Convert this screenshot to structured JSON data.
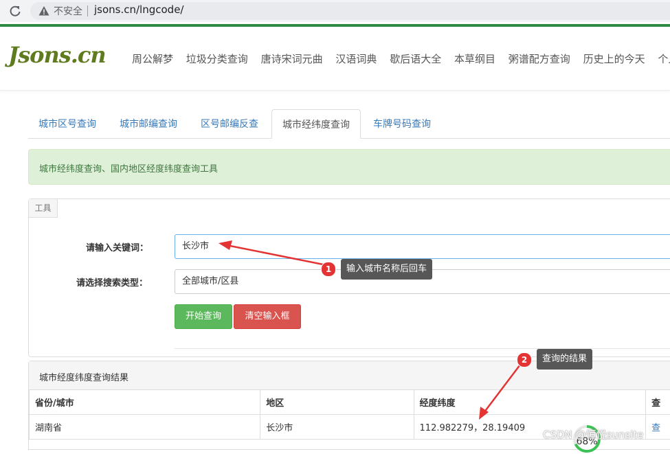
{
  "browser": {
    "insecure_label": "不安全",
    "url": "jsons.cn/lngcode/"
  },
  "site": {
    "logo": "Jsons.cn",
    "nav": [
      "周公解梦",
      "垃圾分类查询",
      "唐诗宋词元曲",
      "汉语词典",
      "歇后语大全",
      "本草纲目",
      "粥谱配方查询",
      "历史上的今天",
      "个人所得"
    ]
  },
  "tabs": [
    {
      "label": "城市区号查询",
      "active": false
    },
    {
      "label": "城市邮编查询",
      "active": false
    },
    {
      "label": "区号邮编反查",
      "active": false
    },
    {
      "label": "城市经纬度查询",
      "active": true
    },
    {
      "label": "车牌号码查询",
      "active": false
    }
  ],
  "alert": "城市经纬度查询、国内地区经度纬度查询工具",
  "tool": {
    "tag": "工具",
    "keyword_label": "请输入关键词：",
    "keyword_value": "长沙市",
    "type_label": "请选择搜索类型：",
    "type_value": "全部城市/区县",
    "search_button": "开始查询",
    "clear_button": "清空输入框"
  },
  "results": {
    "title": "城市经度纬度查询结果",
    "columns": [
      "省份/城市",
      "地区",
      "经度纬度",
      "查"
    ],
    "rows": [
      [
        "湖南省",
        "长沙市",
        "112.982279，28.19409",
        "查"
      ]
    ]
  },
  "annotations": [
    {
      "number": "1",
      "text": "输入城市名称后回车"
    },
    {
      "number": "2",
      "text": "查询的结果"
    }
  ],
  "watermark": "CSDN @恒悦sunsite",
  "gauge": {
    "label": "68%",
    "value": 68,
    "color": "#3cc155"
  },
  "colors": {
    "accent_green": "#2e8b45",
    "link_blue": "#3a7ab8",
    "annotation_red": "#e33333"
  }
}
